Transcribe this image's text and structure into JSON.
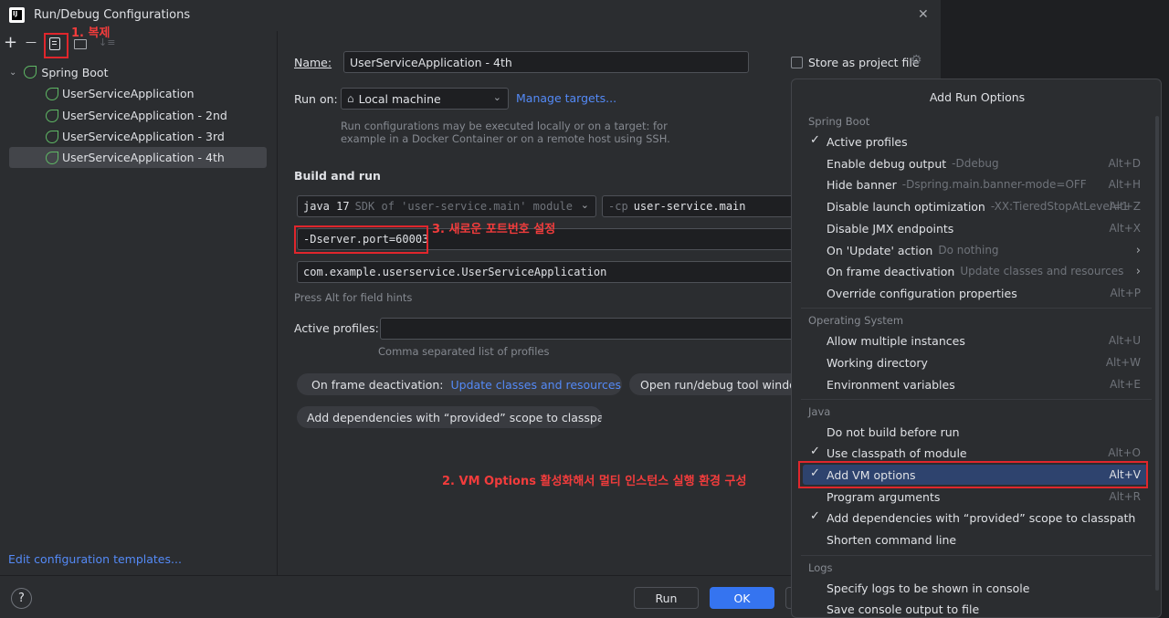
{
  "window": {
    "title": "Run/Debug Configurations",
    "close_glyph": "✕"
  },
  "toolbar": {
    "add_glyph": "+",
    "remove_glyph": "—",
    "annotation_copy": "1. 복제"
  },
  "tree": {
    "group_label": "Spring Boot",
    "items": [
      {
        "label": "UserServiceApplication"
      },
      {
        "label": "UserServiceApplication - 2nd"
      },
      {
        "label": "UserServiceApplication - 3rd"
      },
      {
        "label": "UserServiceApplication - 4th"
      }
    ],
    "edit_templates": "Edit configuration templates..."
  },
  "form": {
    "name_label": "Name:",
    "name_value": "UserServiceApplication - 4th",
    "store_label": "Store as project file",
    "run_on_label": "Run on:",
    "run_on_value": "Local machine",
    "manage_targets": "Manage targets...",
    "run_on_hint_1": "Run configurations may be executed locally or on a target: for",
    "run_on_hint_2": "example in a Docker Container or on a remote host using SSH.",
    "build_and_run": "Build and run",
    "jdk_strong": "java 17",
    "jdk_rest": "SDK of 'user-service.main' module",
    "cp_prefix": "-cp",
    "cp_value": "user-service.main",
    "vm_options": "-Dserver.port=60003",
    "annotation_port": "3. 새로운 포트번호 설정",
    "main_class": "com.example.userservice.UserServiceApplication",
    "field_hint": "Press Alt for field hints",
    "active_profiles_label": "Active profiles:",
    "profiles_hint": "Comma separated list of profiles",
    "chip_frame_label": "On frame deactivation:",
    "chip_frame_value": "Update classes and resources",
    "chip_open_window": "Open run/debug tool window w",
    "chip_dependencies": "Add dependencies with “provided” scope to classpath",
    "chip_close": "✕"
  },
  "footer": {
    "help": "?",
    "run": "Run",
    "ok": "OK"
  },
  "annotation_vm": "2. VM Options 활성화해서 멀티 인스턴스 실행 환경 구성",
  "popup": {
    "title": "Add Run Options",
    "sections": {
      "spring_boot": "Spring Boot",
      "os": "Operating System",
      "java": "Java",
      "logs": "Logs"
    },
    "options": [
      {
        "label": "Active profiles",
        "hint": "",
        "shortcut": "",
        "checked": "✓"
      },
      {
        "label": "Enable debug output",
        "hint": "-Ddebug",
        "shortcut": "Alt+D",
        "checked": ""
      },
      {
        "label": "Hide banner",
        "hint": "-Dspring.main.banner-mode=OFF",
        "shortcut": "Alt+H",
        "checked": ""
      },
      {
        "label": "Disable launch optimization",
        "hint": "-XX:TieredStopAtLevel=1",
        "shortcut": "Alt+Z",
        "checked": ""
      },
      {
        "label": "Disable JMX endpoints",
        "hint": "",
        "shortcut": "Alt+X",
        "checked": ""
      },
      {
        "label": "On 'Update' action",
        "hint": "Do nothing",
        "shortcut": "",
        "checked": "",
        "arrow": "›"
      },
      {
        "label": "On frame deactivation",
        "hint": "Update classes and resources",
        "shortcut": "",
        "checked": "",
        "arrow": "›"
      },
      {
        "label": "Override configuration properties",
        "hint": "",
        "shortcut": "Alt+P",
        "checked": ""
      },
      {
        "label": "Allow multiple instances",
        "hint": "",
        "shortcut": "Alt+U",
        "checked": ""
      },
      {
        "label": "Working directory",
        "hint": "",
        "shortcut": "Alt+W",
        "checked": ""
      },
      {
        "label": "Environment variables",
        "hint": "",
        "shortcut": "Alt+E",
        "checked": ""
      },
      {
        "label": "Do not build before run",
        "hint": "",
        "shortcut": "",
        "checked": ""
      },
      {
        "label": "Use classpath of module",
        "hint": "",
        "shortcut": "Alt+O",
        "checked": "✓"
      },
      {
        "label": "Add VM options",
        "hint": "",
        "shortcut": "Alt+V",
        "checked": "✓"
      },
      {
        "label": "Program arguments",
        "hint": "",
        "shortcut": "Alt+R",
        "checked": ""
      },
      {
        "label": "Add dependencies with “provided” scope to classpath",
        "hint": "",
        "shortcut": "",
        "checked": "✓"
      },
      {
        "label": "Shorten command line",
        "hint": "",
        "shortcut": "",
        "checked": ""
      },
      {
        "label": "Specify logs to be shown in console",
        "hint": "",
        "shortcut": "",
        "checked": ""
      },
      {
        "label": "Save console output to file",
        "hint": "",
        "shortcut": "",
        "checked": ""
      }
    ]
  },
  "colors": {
    "accent": "#3574f0",
    "link": "#548af7",
    "annotation_red": "#e0262c",
    "selection": "#2e436e"
  }
}
